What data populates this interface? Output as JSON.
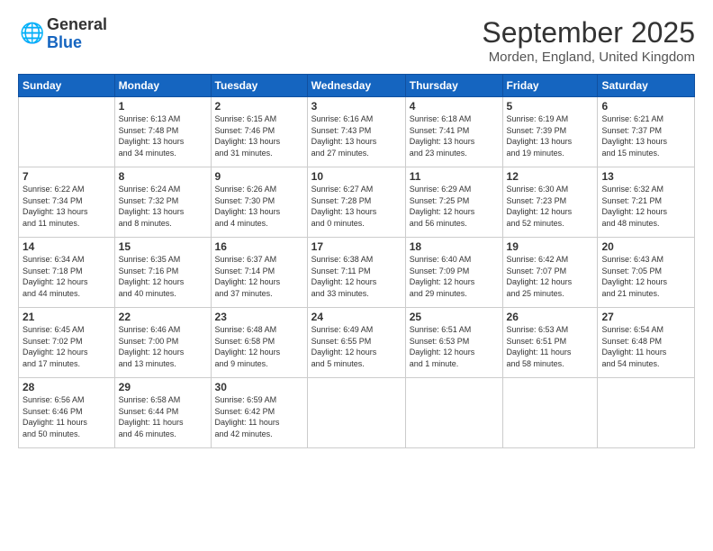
{
  "logo": {
    "general": "General",
    "blue": "Blue"
  },
  "title": "September 2025",
  "location": "Morden, England, United Kingdom",
  "weekdays": [
    "Sunday",
    "Monday",
    "Tuesday",
    "Wednesday",
    "Thursday",
    "Friday",
    "Saturday"
  ],
  "weeks": [
    [
      {
        "day": "",
        "info": ""
      },
      {
        "day": "1",
        "info": "Sunrise: 6:13 AM\nSunset: 7:48 PM\nDaylight: 13 hours\nand 34 minutes."
      },
      {
        "day": "2",
        "info": "Sunrise: 6:15 AM\nSunset: 7:46 PM\nDaylight: 13 hours\nand 31 minutes."
      },
      {
        "day": "3",
        "info": "Sunrise: 6:16 AM\nSunset: 7:43 PM\nDaylight: 13 hours\nand 27 minutes."
      },
      {
        "day": "4",
        "info": "Sunrise: 6:18 AM\nSunset: 7:41 PM\nDaylight: 13 hours\nand 23 minutes."
      },
      {
        "day": "5",
        "info": "Sunrise: 6:19 AM\nSunset: 7:39 PM\nDaylight: 13 hours\nand 19 minutes."
      },
      {
        "day": "6",
        "info": "Sunrise: 6:21 AM\nSunset: 7:37 PM\nDaylight: 13 hours\nand 15 minutes."
      }
    ],
    [
      {
        "day": "7",
        "info": "Sunrise: 6:22 AM\nSunset: 7:34 PM\nDaylight: 13 hours\nand 11 minutes."
      },
      {
        "day": "8",
        "info": "Sunrise: 6:24 AM\nSunset: 7:32 PM\nDaylight: 13 hours\nand 8 minutes."
      },
      {
        "day": "9",
        "info": "Sunrise: 6:26 AM\nSunset: 7:30 PM\nDaylight: 13 hours\nand 4 minutes."
      },
      {
        "day": "10",
        "info": "Sunrise: 6:27 AM\nSunset: 7:28 PM\nDaylight: 13 hours\nand 0 minutes."
      },
      {
        "day": "11",
        "info": "Sunrise: 6:29 AM\nSunset: 7:25 PM\nDaylight: 12 hours\nand 56 minutes."
      },
      {
        "day": "12",
        "info": "Sunrise: 6:30 AM\nSunset: 7:23 PM\nDaylight: 12 hours\nand 52 minutes."
      },
      {
        "day": "13",
        "info": "Sunrise: 6:32 AM\nSunset: 7:21 PM\nDaylight: 12 hours\nand 48 minutes."
      }
    ],
    [
      {
        "day": "14",
        "info": "Sunrise: 6:34 AM\nSunset: 7:18 PM\nDaylight: 12 hours\nand 44 minutes."
      },
      {
        "day": "15",
        "info": "Sunrise: 6:35 AM\nSunset: 7:16 PM\nDaylight: 12 hours\nand 40 minutes."
      },
      {
        "day": "16",
        "info": "Sunrise: 6:37 AM\nSunset: 7:14 PM\nDaylight: 12 hours\nand 37 minutes."
      },
      {
        "day": "17",
        "info": "Sunrise: 6:38 AM\nSunset: 7:11 PM\nDaylight: 12 hours\nand 33 minutes."
      },
      {
        "day": "18",
        "info": "Sunrise: 6:40 AM\nSunset: 7:09 PM\nDaylight: 12 hours\nand 29 minutes."
      },
      {
        "day": "19",
        "info": "Sunrise: 6:42 AM\nSunset: 7:07 PM\nDaylight: 12 hours\nand 25 minutes."
      },
      {
        "day": "20",
        "info": "Sunrise: 6:43 AM\nSunset: 7:05 PM\nDaylight: 12 hours\nand 21 minutes."
      }
    ],
    [
      {
        "day": "21",
        "info": "Sunrise: 6:45 AM\nSunset: 7:02 PM\nDaylight: 12 hours\nand 17 minutes."
      },
      {
        "day": "22",
        "info": "Sunrise: 6:46 AM\nSunset: 7:00 PM\nDaylight: 12 hours\nand 13 minutes."
      },
      {
        "day": "23",
        "info": "Sunrise: 6:48 AM\nSunset: 6:58 PM\nDaylight: 12 hours\nand 9 minutes."
      },
      {
        "day": "24",
        "info": "Sunrise: 6:49 AM\nSunset: 6:55 PM\nDaylight: 12 hours\nand 5 minutes."
      },
      {
        "day": "25",
        "info": "Sunrise: 6:51 AM\nSunset: 6:53 PM\nDaylight: 12 hours\nand 1 minute."
      },
      {
        "day": "26",
        "info": "Sunrise: 6:53 AM\nSunset: 6:51 PM\nDaylight: 11 hours\nand 58 minutes."
      },
      {
        "day": "27",
        "info": "Sunrise: 6:54 AM\nSunset: 6:48 PM\nDaylight: 11 hours\nand 54 minutes."
      }
    ],
    [
      {
        "day": "28",
        "info": "Sunrise: 6:56 AM\nSunset: 6:46 PM\nDaylight: 11 hours\nand 50 minutes."
      },
      {
        "day": "29",
        "info": "Sunrise: 6:58 AM\nSunset: 6:44 PM\nDaylight: 11 hours\nand 46 minutes."
      },
      {
        "day": "30",
        "info": "Sunrise: 6:59 AM\nSunset: 6:42 PM\nDaylight: 11 hours\nand 42 minutes."
      },
      {
        "day": "",
        "info": ""
      },
      {
        "day": "",
        "info": ""
      },
      {
        "day": "",
        "info": ""
      },
      {
        "day": "",
        "info": ""
      }
    ]
  ]
}
